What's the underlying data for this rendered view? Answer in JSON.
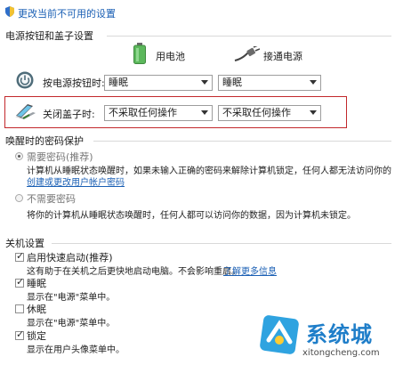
{
  "top": {
    "link": "更改当前不可用的设置"
  },
  "sections": {
    "power_buttons_title": "电源按钮和盖子设置",
    "password_title": "唤醒时的密码保护",
    "shutdown_title": "关机设置"
  },
  "columns": {
    "battery": "用电池",
    "plugged": "接通电源"
  },
  "power_button": {
    "label": "按电源按钮时:",
    "battery_value": "睡眠",
    "plugged_value": "睡眠"
  },
  "lid": {
    "label": "关闭盖子时:",
    "battery_value": "不采取任何操作",
    "plugged_value": "不采取任何操作"
  },
  "password": {
    "require_label": "需要密码(推荐)",
    "require_desc": "计算机从睡眠状态唤醒时，如果未输入正确的密码来解除计算机锁定，任何人都无法访问你的",
    "require_link": "创建或更改用户帐户密码",
    "no_require_label": "不需要密码",
    "no_require_desc": "将你的计算机从睡眠状态唤醒时，任何人都可以访问你的数据，因为计算机未锁定。"
  },
  "shutdown": {
    "fast_startup_label": "启用快速启动(推荐)",
    "fast_startup_desc": "这有助于在关机之后更快地启动电脑。不会影响重启。",
    "fast_startup_link": "了解更多信息",
    "sleep_label": "睡眠",
    "sleep_desc": "显示在\"电源\"菜单中。",
    "hibernate_label": "休眠",
    "hibernate_desc": "显示在\"电源\"菜单中。",
    "lock_label": "锁定",
    "lock_desc": "显示在用户头像菜单中。"
  },
  "watermark": {
    "text": "系统城",
    "url": "xitongcheng.com"
  },
  "colors": {
    "highlight": "#c2282c",
    "link": "#1a5fb4",
    "battery_green": "#5cb85c"
  }
}
